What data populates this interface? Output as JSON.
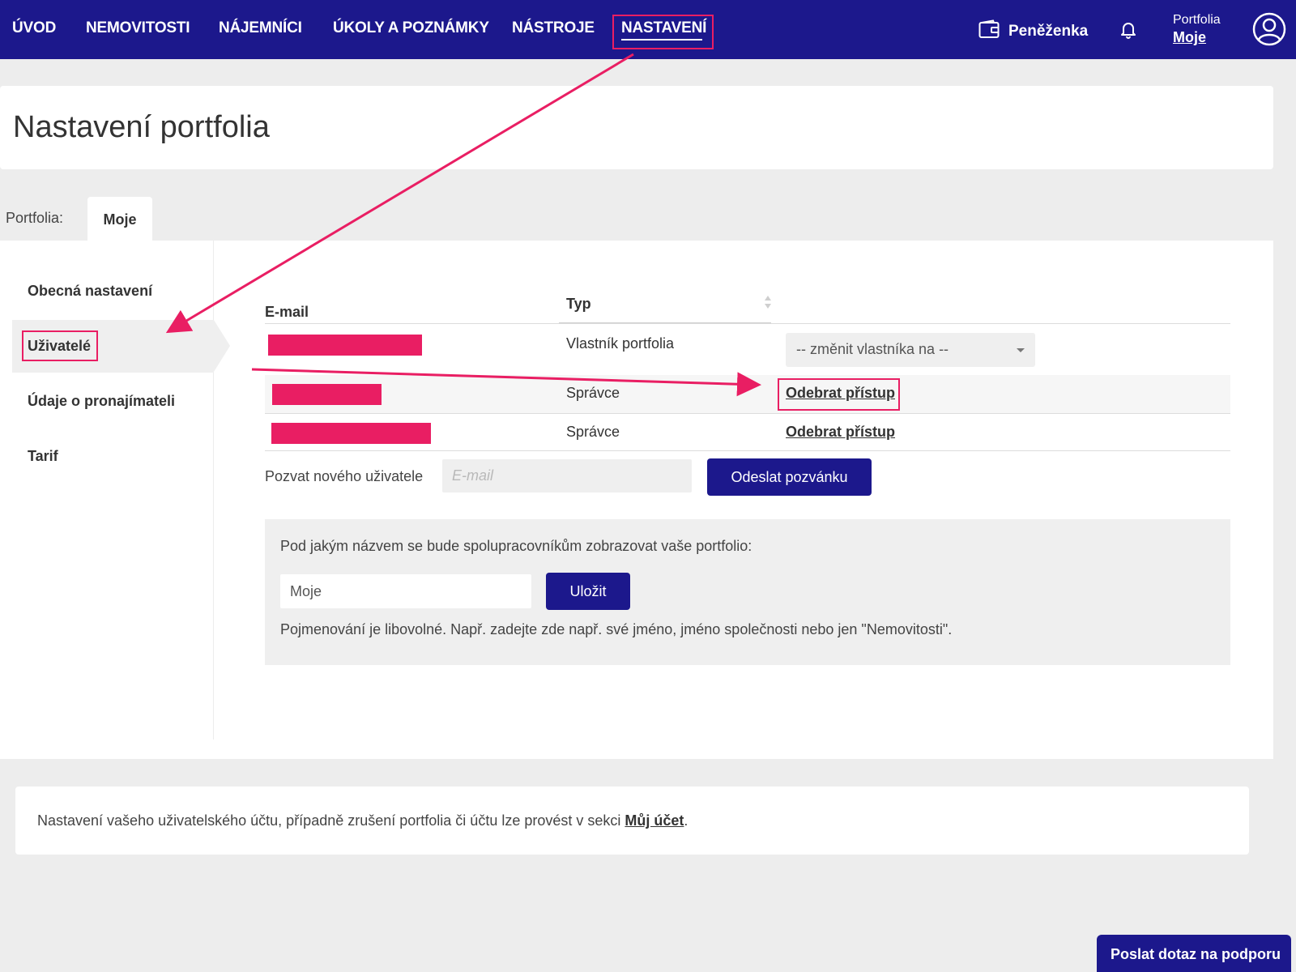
{
  "nav": {
    "items": [
      "ÚVOD",
      "NEMOVITOSTI",
      "NÁJEMNÍCI",
      "ÚKOLY A POZNÁMKY",
      "NÁSTROJE",
      "NASTAVENÍ"
    ],
    "active": "NASTAVENÍ",
    "wallet_label": "Peněženka",
    "portfolio_label": "Portfolia",
    "portfolio_value": "Moje"
  },
  "header": {
    "title": "Nastavení portfolia"
  },
  "portfolio_tabs": {
    "label": "Portfolia:",
    "tabs": [
      "Moje"
    ],
    "active": "Moje"
  },
  "sidebar": {
    "items": [
      "Obecná nastavení",
      "Uživatelé",
      "Údaje o pronajímateli",
      "Tarif"
    ],
    "active": "Uživatelé"
  },
  "users_table": {
    "columns": {
      "email": "E-mail",
      "type": "Typ"
    },
    "rows": [
      {
        "type": "Vlastník portfolia",
        "action": "-- změnit vlastníka na --"
      },
      {
        "type": "Správce",
        "action": "Odebrat přístup"
      },
      {
        "type": "Správce",
        "action": "Odebrat přístup"
      }
    ]
  },
  "invite": {
    "label": "Pozvat nového uživatele",
    "placeholder": "E-mail",
    "button": "Odeslat pozvánku"
  },
  "portfolio_name": {
    "question": "Pod jakým názvem se bude spolupracovníkům zobrazovat vaše portfolio:",
    "value": "Moje",
    "save_button": "Uložit",
    "hint": "Pojmenování je libovolné. Např. zadejte zde např. své jméno, jméno společnosti nebo jen \"Nemovitosti\"."
  },
  "footer_note": {
    "text_before": "Nastavení vašeho uživatelského účtu, případně zrušení portfolia či účtu lze provést v sekci ",
    "link": "Můj účet",
    "text_after": "."
  },
  "support_button": "Poslat dotaz na podporu",
  "colors": {
    "nav_bg": "#1c188c",
    "annotation": "#e91e63",
    "page_bg": "#ededed"
  }
}
